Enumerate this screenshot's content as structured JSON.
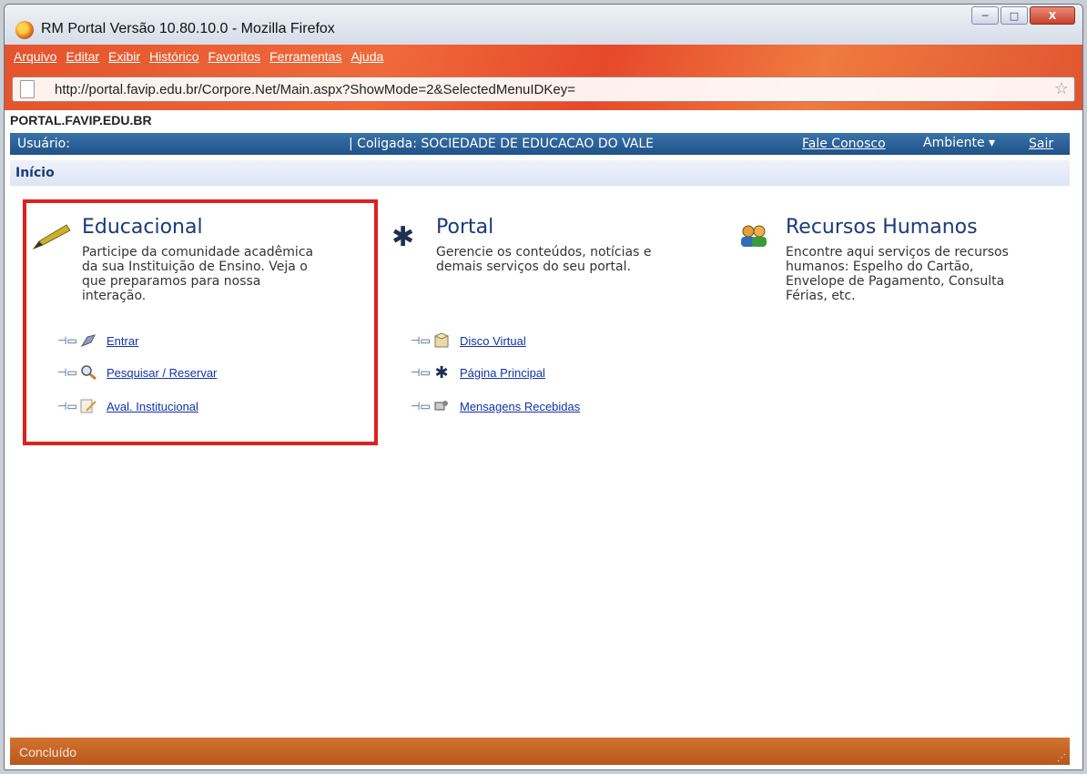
{
  "window": {
    "title": "RM Portal Versão 10.80.10.0 - Mozilla Firefox",
    "controls": {
      "minimize": "─",
      "maximize": "□",
      "close": "X"
    }
  },
  "menubar": [
    "Arquivo",
    "Editar",
    "Exibir",
    "Histórico",
    "Favoritos",
    "Ferramentas",
    "Ajuda"
  ],
  "address": {
    "url": "http://portal.favip.edu.br/Corpore.Net/Main.aspx?ShowMode=2&SelectedMenuIDKey="
  },
  "site": {
    "name": "PORTAL.FAVIP.EDU.BR",
    "user_label": "Usuário:",
    "coligada": "| Coligada: SOCIEDADE DE EDUCACAO DO VALE",
    "contact": "Fale Conosco",
    "environment": "Ambiente ▾",
    "logout": "Sair",
    "breadcrumb": "Início"
  },
  "sections": {
    "educacional": {
      "title": "Educacional",
      "lines": [
        "Participe da comunidade acadêmica",
        "da sua Instituição de Ensino. Veja o",
        "que preparamos para nossa",
        "interação."
      ],
      "links": [
        "Entrar",
        "Pesquisar / Reservar",
        "Aval. Institucional"
      ]
    },
    "portal": {
      "title": "Portal",
      "lines": [
        "Gerencie os conteúdos, notícias e",
        "demais serviços do seu portal."
      ],
      "links": [
        "Disco Virtual",
        "Página Principal",
        "Mensagens Recebidas"
      ]
    },
    "rh": {
      "title": "Recursos Humanos",
      "lines": [
        "Encontre aqui serviços de recursos",
        "humanos: Espelho do Cartão,",
        "Envelope de Pagamento, Consulta",
        "Férias, etc."
      ]
    }
  },
  "status": {
    "text": "Concluído"
  },
  "colors": {
    "highlight": "#e02020",
    "header": "#1f5289",
    "link": "#1133aa"
  }
}
